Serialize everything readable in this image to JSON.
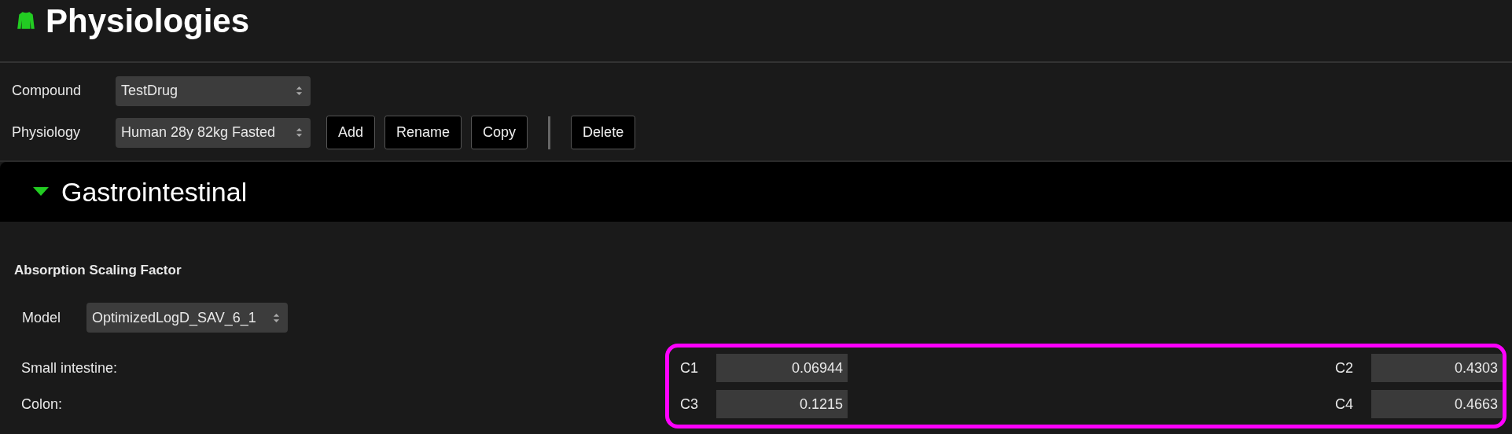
{
  "header": {
    "title": "Physiologies"
  },
  "selectors": [
    {
      "label": "Compound",
      "value": "TestDrug"
    },
    {
      "label": "Physiology",
      "value": "Human 28y 82kg Fasted"
    }
  ],
  "actions": [
    {
      "kind": "button",
      "label": "Add"
    },
    {
      "kind": "button",
      "label": "Rename"
    },
    {
      "kind": "button",
      "label": "Copy"
    },
    {
      "kind": "separator"
    },
    {
      "kind": "button",
      "label": "Delete"
    }
  ],
  "section": {
    "title": "Gastrointestinal",
    "expanded": true
  },
  "group": {
    "title": "Absorption Scaling Factor",
    "model": {
      "label": "Model",
      "value": "OptimizedLogD_SAV_6_1"
    },
    "highlighted": true,
    "rows": [
      {
        "label": "Small intestine:",
        "coefficients": [
          {
            "name": "C1",
            "value": "0.06944"
          },
          {
            "name": "C2",
            "value": "0.4303"
          }
        ]
      },
      {
        "label": "Colon:",
        "coefficients": [
          {
            "name": "C3",
            "value": "0.1215"
          },
          {
            "name": "C4",
            "value": "0.4663"
          }
        ]
      }
    ]
  }
}
